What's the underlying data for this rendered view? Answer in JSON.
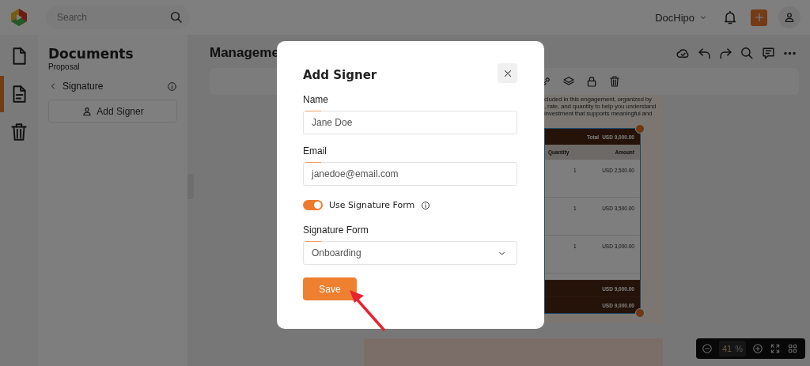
{
  "top_bar": {
    "search": {
      "placeholder": "Search"
    },
    "workspace": "DocHipo"
  },
  "rail": [
    {
      "kind": "file",
      "selected": false
    },
    {
      "kind": "document",
      "selected": true
    },
    {
      "kind": "trash",
      "selected": false
    }
  ],
  "panel": {
    "title": "Documents",
    "subtitle": "Proposal",
    "section": "Signature",
    "add_button": "Add Signer"
  },
  "editor": {
    "title": "Manageme",
    "document": {
      "text_lines": [
        "cluded in this engagement, organized by",
        ", rate, and quantity to help you understand",
        "investment that supports meaningful and"
      ],
      "table": {
        "total_label": "Total",
        "total_value": "USD 9,000.00",
        "columns": [
          "Quantity",
          "Amount"
        ],
        "rows": [
          {
            "quantity": "1",
            "amount": "USD 2,500.00"
          },
          {
            "quantity": "1",
            "amount": "USD 3,500.00"
          },
          {
            "quantity": "1",
            "amount": "USD 3,000.00"
          }
        ],
        "footer": [
          "USD 9,000.00",
          "USD 9,000.00"
        ]
      }
    }
  },
  "zoom": {
    "value": "41",
    "unit": "%"
  },
  "dialog": {
    "title": "Add Signer",
    "fields": [
      {
        "kind": "text",
        "label": "Name",
        "value": "Jane Doe"
      },
      {
        "kind": "text",
        "label": "Email",
        "value": "janedoe@email.com"
      },
      {
        "kind": "toggle",
        "label": "Use Signature Form",
        "on": true
      },
      {
        "kind": "select",
        "label": "Signature Form",
        "value": "Onboarding"
      }
    ],
    "save_button": "Save"
  }
}
